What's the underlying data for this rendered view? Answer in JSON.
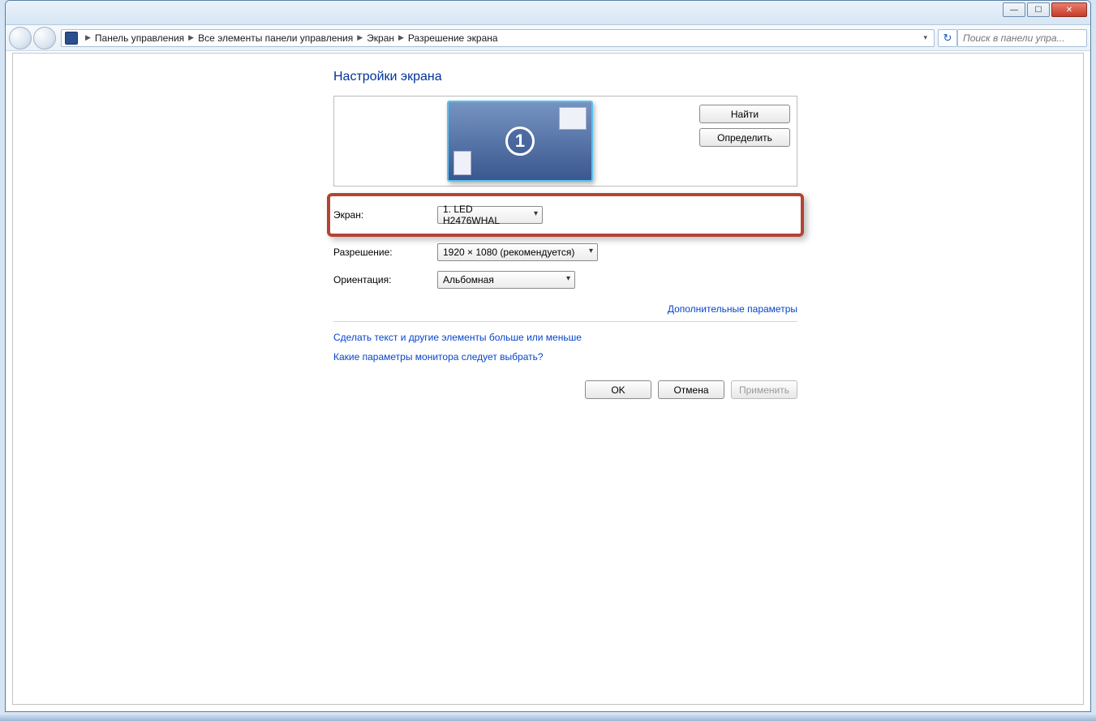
{
  "breadcrumb": {
    "items": [
      "Панель управления",
      "Все элементы панели управления",
      "Экран",
      "Разрешение экрана"
    ]
  },
  "search": {
    "placeholder": "Поиск в панели упра..."
  },
  "page": {
    "title": "Настройки экрана",
    "monitor_number": "1",
    "find_btn": "Найти",
    "identify_btn": "Определить",
    "fields": {
      "display_label": "Экран:",
      "display_value": "1. LED H2476WHAL",
      "resolution_label": "Разрешение:",
      "resolution_value": "1920 × 1080 (рекомендуется)",
      "orientation_label": "Ориентация:",
      "orientation_value": "Альбомная"
    },
    "advanced_link": "Дополнительные параметры",
    "help1": "Сделать текст и другие элементы больше или меньше",
    "help2": "Какие параметры монитора следует выбрать?",
    "ok": "OK",
    "cancel": "Отмена",
    "apply": "Применить"
  }
}
